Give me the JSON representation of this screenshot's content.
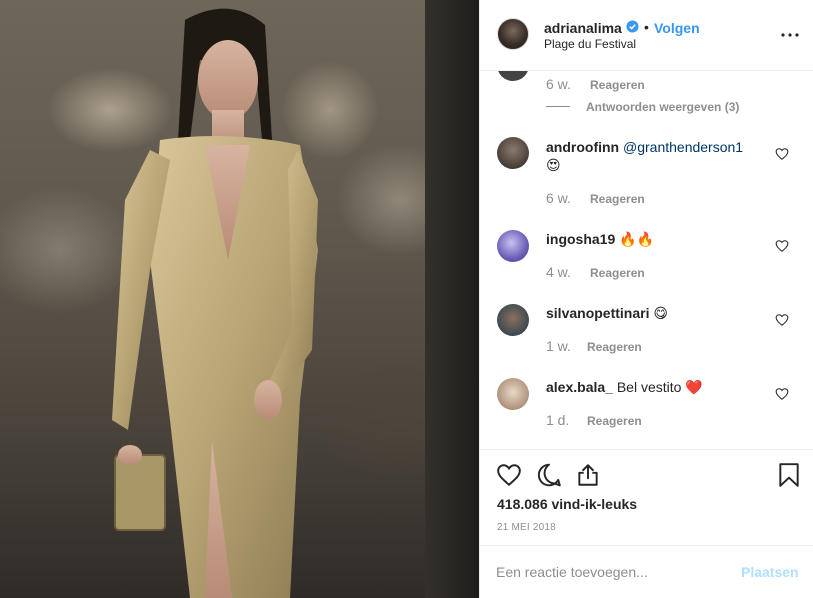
{
  "post": {
    "image_alt": "adrianalima photo"
  },
  "header": {
    "username": "adrianalima",
    "dot": "•",
    "follow_label": "Volgen",
    "location": "Plage du Festival"
  },
  "comments": {
    "top": {
      "time": "6 w.",
      "reply_label": "Reageren",
      "view_replies_label": "Antwoorden weergeven (3)"
    },
    "items": [
      {
        "user": "androofinn",
        "mention": "@granthenderson1",
        "text": "😍",
        "time": "6 w.",
        "reply_label": "Reageren"
      },
      {
        "user": "ingosha19",
        "text": "🔥🔥",
        "time": "4 w.",
        "reply_label": "Reageren"
      },
      {
        "user": "silvanopettinari",
        "text": "😋",
        "time": "1 w.",
        "reply_label": "Reageren"
      },
      {
        "user": "alex.bala_",
        "text": "Bel vestito ❤️",
        "time": "1 d.",
        "reply_label": "Reageren"
      }
    ]
  },
  "actions": {
    "likes": "418.086 vind-ik-leuks",
    "date": "21 MEI 2018"
  },
  "composer": {
    "placeholder": "Een reactie toevoegen...",
    "post_label": "Plaatsen"
  },
  "colors": {
    "accent": "#3897f0",
    "post_disabled": "#b2dffc",
    "muted": "#8e8e8e"
  }
}
